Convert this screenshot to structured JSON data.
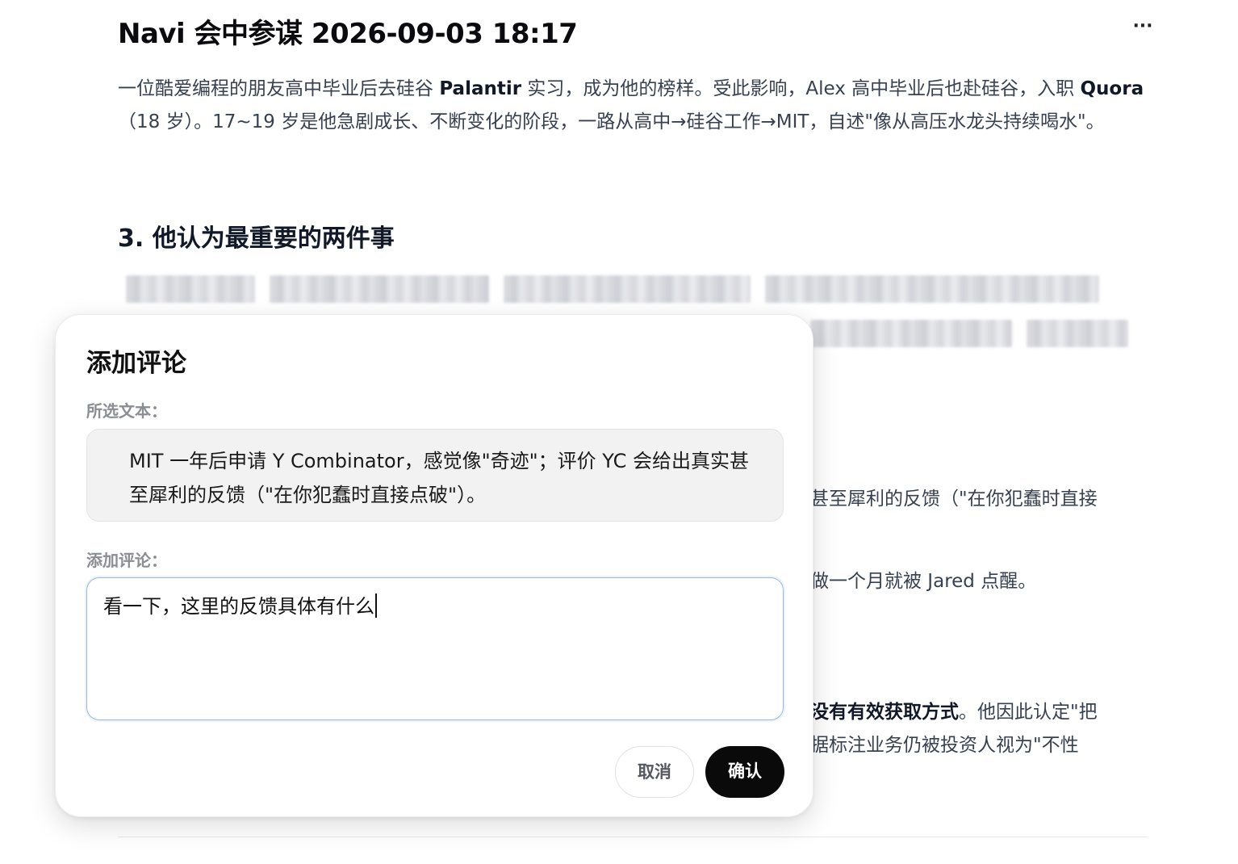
{
  "document": {
    "title": "Navi 会中参谋 2026-09-03 18:17",
    "more_icon": "···",
    "paragraph": {
      "seg1": "一位酷爱编程的朋友高中毕业后去硅谷 ",
      "bold1": "Palantir",
      "seg2": " 实习，成为他的榜样。受此影响，Alex 高中毕业后也赴硅谷，入职 ",
      "bold2": "Quora",
      "seg3": "（18 岁）。17~19 岁是他急剧成长、不断变化的阶段，一路从高中→硅谷工作→MIT，自述\"像从高压水龙头持续喝水\"。"
    },
    "section_heading": "3. 他认为最重要的两件事",
    "partial_lines": {
      "line1": "甚至犀利的反馈（\"在你犯蠢时直接",
      "line2": "做一个月就被 Jared 点醒。",
      "line3_bold": "没有有效获取方式",
      "line3_rest": "。他因此认定\"把",
      "line4": "据标注业务仍被投资人视为\"不性"
    }
  },
  "dialog": {
    "title": "添加评论",
    "selected_label": "所选文本：",
    "selected_text": "MIT 一年后申请 Y Combinator，感觉像\"奇迹\"；评价 YC 会给出真实甚至犀利的反馈（\"在你犯蠢时直接点破\"）。",
    "comment_label": "添加评论：",
    "comment_value": "看一下，这里的反馈具体有什么",
    "cancel_label": "取消",
    "confirm_label": "确认"
  },
  "colors": {
    "confirm_button_bg": "#0a0a0a",
    "input_focus_border": "#9db8e8",
    "quote_box_bg": "#f2f2f3"
  }
}
